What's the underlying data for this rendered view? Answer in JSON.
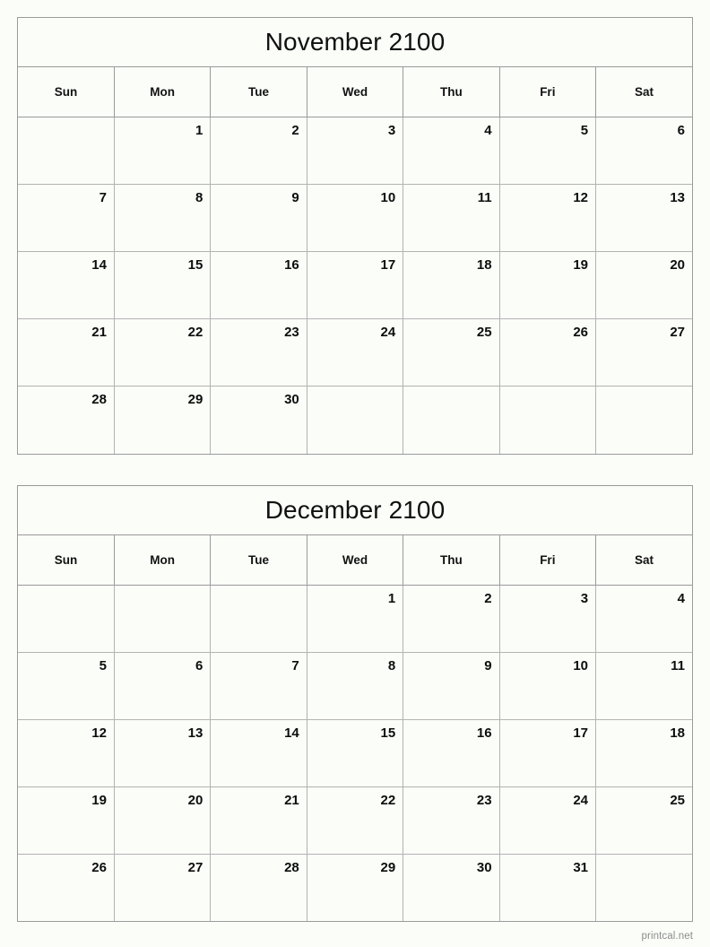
{
  "page": {
    "watermark": "printcal.net",
    "background_color": "#fbfdf8",
    "border_color": "#9a9a9a",
    "inner_border_color": "#b3b3b3",
    "text_color": "#0d0d0d"
  },
  "calendars": [
    {
      "title": "November 2100",
      "weekday_headers": [
        "Sun",
        "Mon",
        "Tue",
        "Wed",
        "Thu",
        "Fri",
        "Sat"
      ],
      "weeks": [
        [
          "",
          "1",
          "2",
          "3",
          "4",
          "5",
          "6"
        ],
        [
          "7",
          "8",
          "9",
          "10",
          "11",
          "12",
          "13"
        ],
        [
          "14",
          "15",
          "16",
          "17",
          "18",
          "19",
          "20"
        ],
        [
          "21",
          "22",
          "23",
          "24",
          "25",
          "26",
          "27"
        ],
        [
          "28",
          "29",
          "30",
          "",
          "",
          "",
          ""
        ]
      ]
    },
    {
      "title": "December 2100",
      "weekday_headers": [
        "Sun",
        "Mon",
        "Tue",
        "Wed",
        "Thu",
        "Fri",
        "Sat"
      ],
      "weeks": [
        [
          "",
          "",
          "",
          "1",
          "2",
          "3",
          "4"
        ],
        [
          "5",
          "6",
          "7",
          "8",
          "9",
          "10",
          "11"
        ],
        [
          "12",
          "13",
          "14",
          "15",
          "16",
          "17",
          "18"
        ],
        [
          "19",
          "20",
          "21",
          "22",
          "23",
          "24",
          "25"
        ],
        [
          "26",
          "27",
          "28",
          "29",
          "30",
          "31",
          ""
        ]
      ]
    }
  ]
}
